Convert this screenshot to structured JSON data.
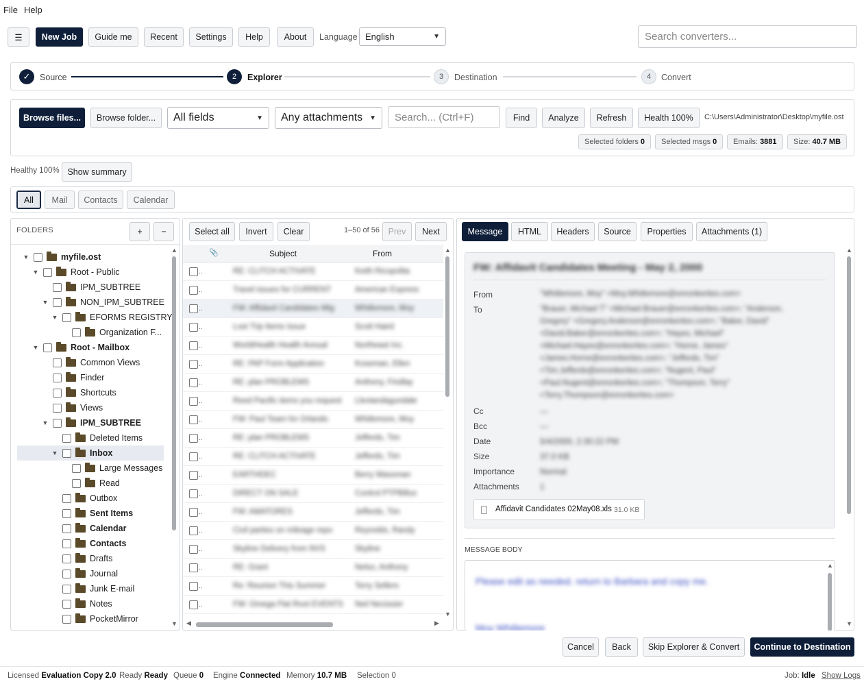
{
  "menu": {
    "file": "File",
    "help": "Help"
  },
  "toolbar": {
    "hamburger": "☰",
    "new_job": "New Job",
    "guide": "Guide me",
    "recent": "Recent",
    "settings": "Settings",
    "help": "Help",
    "about": "About",
    "language_label": "Language",
    "language_value": "English",
    "search_placeholder": "Search converters..."
  },
  "steps": [
    {
      "num": "✓",
      "label": "Source"
    },
    {
      "num": "2",
      "label": "Explorer"
    },
    {
      "num": "3",
      "label": "Destination"
    },
    {
      "num": "4",
      "label": "Convert"
    }
  ],
  "explorer_bar": {
    "browse_files": "Browse files...",
    "browse_folder": "Browse folder...",
    "fields": "All fields",
    "attachments": "Any attachments",
    "search_placeholder": "Search... (Ctrl+F)",
    "find": "Find",
    "analyze": "Analyze",
    "refresh": "Refresh",
    "health": "Health 100%",
    "path": "C:\\Users\\Administrator\\Desktop\\myfile.ost",
    "stats": {
      "sel_folders_label": "Selected folders",
      "sel_folders": "0",
      "sel_msgs_label": "Selected msgs",
      "sel_msgs": "0",
      "emails_label": "Emails:",
      "emails": "3881",
      "size_label": "Size:",
      "size": "40.7 MB"
    }
  },
  "health": {
    "text": "Healthy 100%",
    "show_summary": "Show summary"
  },
  "filters": [
    "All",
    "Mail",
    "Contacts",
    "Calendar"
  ],
  "folders": {
    "title": "FOLDERS",
    "add": "+",
    "remove": "−",
    "tree": [
      {
        "label": "myfile.ost",
        "bold": true,
        "toggle": "▼",
        "indent": 0
      },
      {
        "label": "Root - Public",
        "bold": false,
        "toggle": "▼",
        "indent": 1
      },
      {
        "label": "IPM_SUBTREE",
        "bold": false,
        "toggle": "",
        "indent": 2
      },
      {
        "label": "NON_IPM_SUBTREE",
        "bold": false,
        "toggle": "▼",
        "indent": 2
      },
      {
        "label": "EFORMS REGISTRY",
        "bold": false,
        "toggle": "▼",
        "indent": 3
      },
      {
        "label": "Organization F...",
        "bold": false,
        "toggle": "",
        "indent": 4
      },
      {
        "label": "Root - Mailbox",
        "bold": true,
        "toggle": "▼",
        "indent": 1
      },
      {
        "label": "Common Views",
        "bold": false,
        "toggle": "",
        "indent": 2
      },
      {
        "label": "Finder",
        "bold": false,
        "toggle": "",
        "indent": 2
      },
      {
        "label": "Shortcuts",
        "bold": false,
        "toggle": "",
        "indent": 2
      },
      {
        "label": "Views",
        "bold": false,
        "toggle": "",
        "indent": 2
      },
      {
        "label": "IPM_SUBTREE",
        "bold": true,
        "toggle": "▼",
        "indent": 2
      },
      {
        "label": "Deleted Items",
        "bold": false,
        "toggle": "",
        "indent": 3
      },
      {
        "label": "Inbox",
        "bold": true,
        "toggle": "▼",
        "indent": 3,
        "selected": true
      },
      {
        "label": "Large Messages",
        "bold": false,
        "toggle": "",
        "indent": 4
      },
      {
        "label": "Read",
        "bold": false,
        "toggle": "",
        "indent": 4
      },
      {
        "label": "Outbox",
        "bold": false,
        "toggle": "",
        "indent": 3
      },
      {
        "label": "Sent Items",
        "bold": true,
        "toggle": "",
        "indent": 3
      },
      {
        "label": "Calendar",
        "bold": true,
        "toggle": "",
        "indent": 3
      },
      {
        "label": "Contacts",
        "bold": true,
        "toggle": "",
        "indent": 3
      },
      {
        "label": "Drafts",
        "bold": false,
        "toggle": "",
        "indent": 3
      },
      {
        "label": "Journal",
        "bold": false,
        "toggle": "",
        "indent": 3
      },
      {
        "label": "Junk E-mail",
        "bold": false,
        "toggle": "",
        "indent": 3
      },
      {
        "label": "Notes",
        "bold": false,
        "toggle": "",
        "indent": 3
      },
      {
        "label": "PocketMirror",
        "bold": false,
        "toggle": "",
        "indent": 3
      }
    ]
  },
  "messages": {
    "select_all": "Select all",
    "invert": "Invert",
    "clear": "Clear",
    "range": "1–50 of 56",
    "prev": "Prev",
    "next": "Next",
    "col_subject": "Subject",
    "col_from": "From",
    "rows": [
      {
        "subject": "RE: CLITCH ACTIVATE",
        "from": "Keith Ricopolita"
      },
      {
        "subject": "Travel issues for CURRENT",
        "from": "American Express"
      },
      {
        "subject": "FW: Affidavit Candidates Mtg",
        "from": "Whitlemore, Moy"
      },
      {
        "subject": "Lost Trip Items Issue",
        "from": "Scott Haird"
      },
      {
        "subject": "WorldHealth Health Annual",
        "from": "Northeast Inc."
      },
      {
        "subject": "RE: PAP Form Application",
        "from": "Koseman, Ellen"
      },
      {
        "subject": "RE: plan PROBLEMS",
        "from": "Anthony, Findlay"
      },
      {
        "subject": "Reed Pacific items you request",
        "from": "Llevtandagundale"
      },
      {
        "subject": "FW: Paul Team for Orlando",
        "from": "Whitlemore, Moy"
      },
      {
        "subject": "RE: plan PROBLEMS",
        "from": "Jefferds, Tim"
      },
      {
        "subject": "RE: CLITCH ACTIVATE",
        "from": "Jefferds, Tim"
      },
      {
        "subject": "EARTHDEC",
        "from": "Berry Wassman"
      },
      {
        "subject": "DIRECT ON SALE",
        "from": "Control PTPBillus"
      },
      {
        "subject": "FW: AMATORES",
        "from": "Jefferds, Tim"
      },
      {
        "subject": "Civil parties on mileage repo",
        "from": "Reynolds, Randy"
      },
      {
        "subject": "Skyline Delivery from NVS",
        "from": "Skyline"
      },
      {
        "subject": "RE: Grant",
        "from": "Nelso, Anthony"
      },
      {
        "subject": "Re: Reunion This Summer",
        "from": "Terry Sellers"
      },
      {
        "subject": "FW: Omega Flat Root EVENTS",
        "from": "Neil Necissier"
      }
    ]
  },
  "preview": {
    "tabs": [
      "Message",
      "HTML",
      "Headers",
      "Source",
      "Properties",
      "Attachments (1)"
    ],
    "subject": "FW: Affidavit Candidates Meeting - May 2, 2000",
    "fields": {
      "from_label": "From",
      "from": "\"Whitlemore, Moy\" <Moy.Whitlemore@enronkerites.com>",
      "to_label": "To",
      "to": [
        "\"Brauer, Michael T\" <Michael.Brauer@enronkerites.com>; \"Anderson,",
        "Gregory\" <Gregory.Anderson@enronkerites.com>; \"Baker, David\"",
        "<David.Baker@enronkerites.com>; \"Hayes, Michael\"",
        "<Michael.Hayes@enronkerites.com>; \"Horne, James\"",
        "<James.Horne@enronkerites.com>; \"Jefferds, Tim\"",
        "<Tim.Jefferds@enronkerites.com>; \"Nugent, Paul\"",
        "<Paul.Nugent@enronkerites.com>; \"Thompson, Terry\"",
        "<Terry.Thompson@enronkerites.com>"
      ],
      "cc_label": "Cc",
      "cc": "—",
      "bcc_label": "Bcc",
      "bcc": "—",
      "date_label": "Date",
      "date": "5/4/2000, 2:30:22 PM",
      "size_label": "Size",
      "size": "37.0 KB",
      "importance_label": "Importance",
      "importance": "Normal",
      "attachments_label": "Attachments",
      "attachments": "1"
    },
    "attachment_name": "Affidavit Candidates 02May08.xls",
    "attachment_size": "31.0 KB",
    "body_label": "MESSAGE BODY",
    "body_line1": "Please edit as needed. return to Barbara and copy me.",
    "body_line2": "Moy Whitlemore"
  },
  "footer": {
    "cancel": "Cancel",
    "back": "Back",
    "skip": "Skip Explorer & Convert",
    "continue": "Continue to Destination"
  },
  "statusbar": {
    "licensed_label": "Licensed",
    "licensed": "Evaluation Copy 2.0",
    "ready_label": "Ready",
    "ready": "Ready",
    "queue_label": "Queue",
    "queue": "0",
    "engine_label": "Engine",
    "engine": "Connected",
    "memory_label": "Memory",
    "memory": "10.7 MB",
    "selection_label": "Selection",
    "selection": "0",
    "job_label": "Job:",
    "job": "Idle",
    "show_logs": "Show Logs"
  }
}
